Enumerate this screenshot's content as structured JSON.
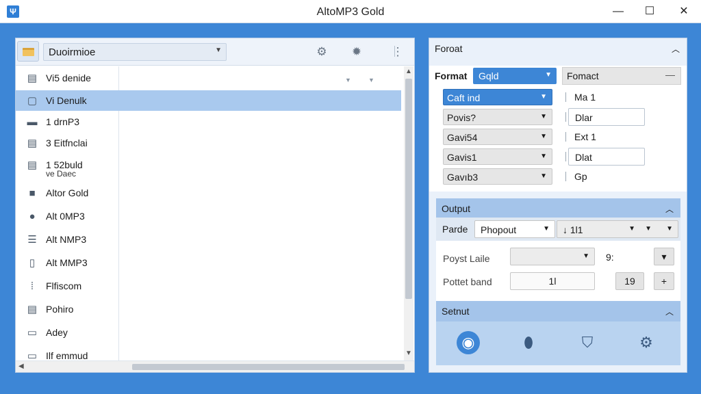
{
  "window": {
    "title": "AltoMP3 Gold",
    "minimize": "—",
    "maximize": "☐",
    "close": "✕"
  },
  "left": {
    "path": "Duoirmioe",
    "files": [
      {
        "icon": "document-icon",
        "label": "Vi5 denide",
        "glyph": "▤"
      },
      {
        "icon": "document-icon",
        "label": "Vi Denulk",
        "glyph": "▢",
        "selected": true
      },
      {
        "icon": "folder-icon",
        "label": "1 drnP3",
        "glyph": "▬"
      },
      {
        "icon": "document-icon",
        "label": "3 Eitfnclai",
        "glyph": "▤"
      },
      {
        "icon": "document-icon",
        "label": "1 52buld",
        "glyph": "▤"
      },
      {
        "icon": "film-icon",
        "label": "Altor Gold",
        "glyph": "■"
      },
      {
        "icon": "disc-icon",
        "label": "Alt 0MP3",
        "glyph": "●"
      },
      {
        "icon": "list-icon",
        "label": "Alt NMP3",
        "glyph": "☰"
      },
      {
        "icon": "phone-icon",
        "label": "Alt MMP3",
        "glyph": "▯"
      },
      {
        "icon": "grid-icon",
        "label": "Flfiscom",
        "glyph": "⁞"
      },
      {
        "icon": "document-icon",
        "label": "Pohiro",
        "glyph": "▤"
      },
      {
        "icon": "note-icon",
        "label": "Adey",
        "glyph": "▭"
      },
      {
        "icon": "chat-icon",
        "label": "Ilf emmud",
        "glyph": "▭"
      }
    ],
    "sub_label": "ve Daec"
  },
  "format": {
    "header": "Foroat",
    "label": "Format",
    "selected": "Gqld",
    "right_header": "Fomact",
    "options": [
      "Caft ind",
      "Povis?",
      "Gavi54",
      "Gavis1",
      "Gavıb3"
    ],
    "right_items": [
      "Ma 1",
      "Dlar",
      "Ext 1",
      "Dlat",
      "Gp"
    ]
  },
  "output": {
    "header": "Output",
    "row1_label": "Parde",
    "row1_combo": "Phopout",
    "row1_combo2": "↓ 1l1",
    "row2_label": "Poyst Laile",
    "row2_small": "9:",
    "row3_label": "Pottet band",
    "row3_value": "1l",
    "row3_btn": "19"
  },
  "settings": {
    "header": "Setnut",
    "icons": [
      "disc-icon",
      "mouse-icon",
      "shield-icon",
      "gear-icon"
    ]
  }
}
